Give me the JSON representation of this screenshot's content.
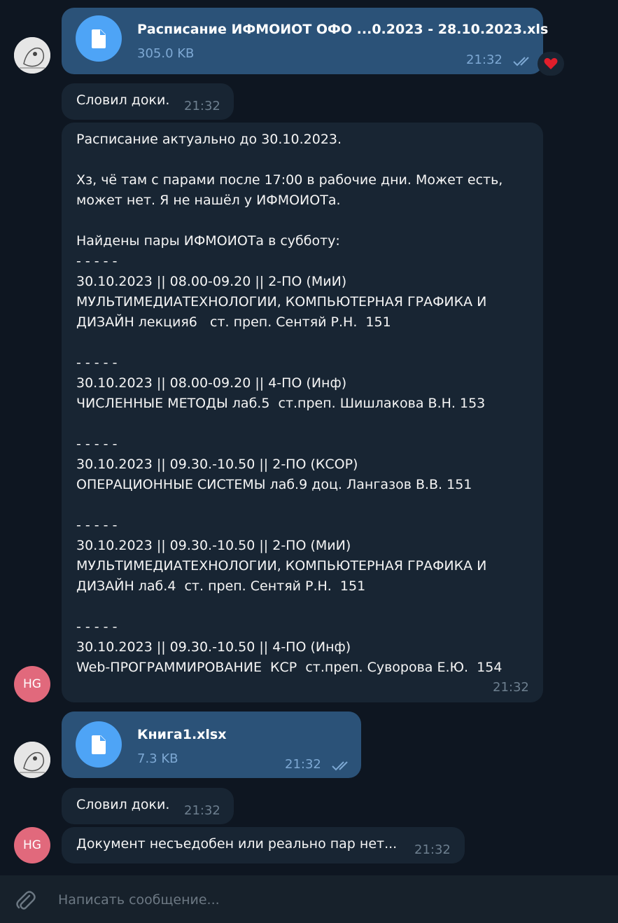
{
  "messages": [
    {
      "file_name": "Расписание ИФМОИОТ ОФО ...0.2023 - 28.10.2023.xls",
      "file_size": "305.0 KB",
      "time": "21:32",
      "reaction": "❤️"
    },
    {
      "text": "Словил доки.",
      "time": "21:32"
    },
    {
      "text": "Расписание актуально до 30.10.2023.\n\nХз, чё там с парами после 17:00 в рабочие дни. Может есть,\nможет нет. Я не нашёл у ИФМОИОТа.\n\nНайдены пары ИФМОИОТа в субботу:\n- - - - -\n30.10.2023 || 08.00-09.20 || 2-ПО (МиИ)\nМУЛЬТИМЕДИАТЕХНОЛОГИИ, КОМПЬЮТЕРНАЯ ГРАФИКА И\nДИЗАЙН лекция6   ст. преп. Сентяй Р.Н.  151\n\n- - - - -\n30.10.2023 || 08.00-09.20 || 4-ПО (Инф)\nЧИСЛЕННЫЕ МЕТОДЫ лаб.5  ст.преп. Шишлакова В.Н. 153\n\n- - - - -\n30.10.2023 || 09.30.-10.50 || 2-ПО (КСОР)\nОПЕРАЦИОННЫЕ СИСТЕМЫ лаб.9 доц. Лангазов В.В. 151\n\n- - - - -\n30.10.2023 || 09.30.-10.50 || 2-ПО (МиИ)\nМУЛЬТИМЕДИАТЕХНОЛОГИИ, КОМПЬЮТЕРНАЯ ГРАФИКА И\nДИЗАЙН лаб.4  ст. преп. Сентяй Р.Н.  151\n\n- - - - -\n30.10.2023 || 09.30.-10.50 || 4-ПО (Инф)\nWeb-ПРОГРАММИРОВАНИЕ  КСР  ст.преп. Суворова Е.Ю.  154",
      "time": "21:32"
    },
    {
      "file_name": "Книга1.xlsx",
      "file_size": "7.3 KB",
      "time": "21:32"
    },
    {
      "text": "Словил доки.",
      "time": "21:32"
    },
    {
      "text": "Документ несъедобен или реально пар нет...",
      "time": "21:32"
    }
  ],
  "avatars": {
    "hg_initials": "HG"
  },
  "input": {
    "placeholder": "Написать сообщение..."
  },
  "colors": {
    "background": "#0e1621",
    "outgoing": "#2b5278",
    "incoming": "#182533",
    "accent": "#4ea4f6",
    "avatar_hg": "#e1697c"
  }
}
